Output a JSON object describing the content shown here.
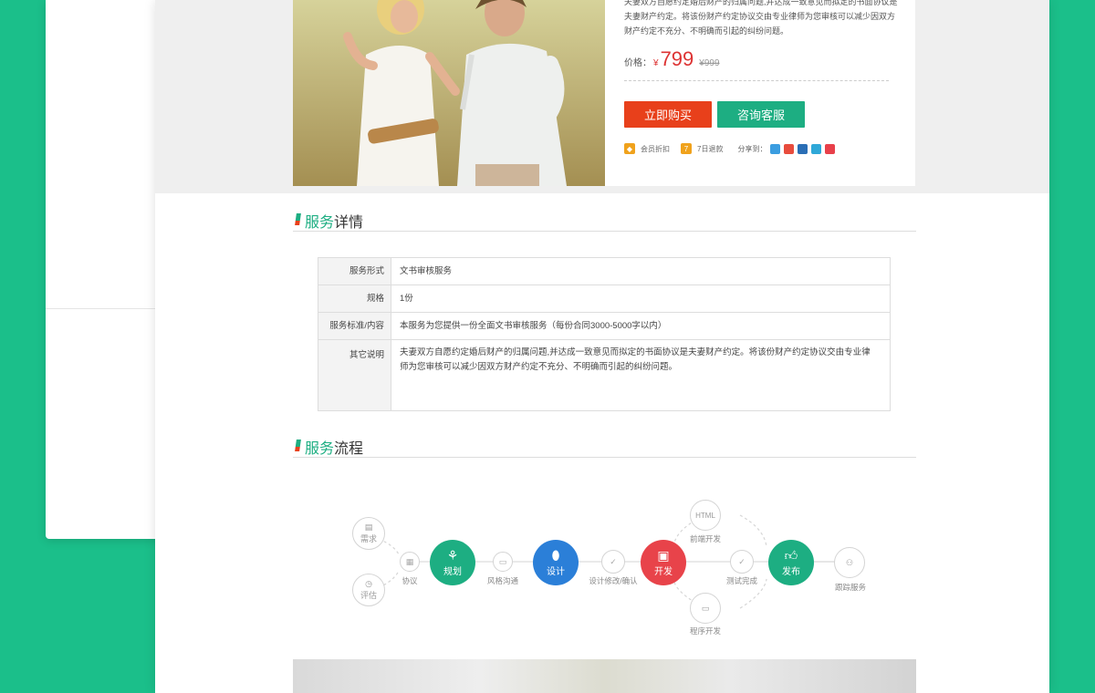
{
  "product": {
    "description": "夫妻双方自愿约定婚后财产的归属问题,并达成一致意见而拟定的书面协议是夫妻财产约定。将该份财产约定协议交由专业律师为您审核可以减少因双方财产约定不充分、不明确而引起的纠纷问题。",
    "price_label": "价格：",
    "currency": "¥",
    "price": "799",
    "old_price": "¥999",
    "buy_label": "立即购买",
    "service_label": "咨询客服",
    "perks": [
      {
        "icon": "member-discount-icon",
        "label": "会员折扣",
        "color": "#f0a21c"
      },
      {
        "icon": "seven-day-refund-icon",
        "label": "7日退款",
        "icon_text": "7",
        "color": "#f0a21c"
      }
    ],
    "share_label": "分享到：",
    "share_icons": [
      {
        "name": "qzone-share-icon",
        "color": "#3b9de0"
      },
      {
        "name": "weibo-share-icon",
        "color": "#e84c3d"
      },
      {
        "name": "renren-share-icon",
        "color": "#2a6eb5"
      },
      {
        "name": "qq-share-icon",
        "color": "#2fa8d8"
      },
      {
        "name": "douban-share-icon",
        "color": "#e8404a"
      }
    ]
  },
  "details": {
    "title_green": "服务",
    "title_dark": "详情",
    "rows": [
      {
        "key": "服务形式",
        "value": "文书审核服务"
      },
      {
        "key": "规格",
        "value": "1份"
      },
      {
        "key": "服务标准/内容",
        "value": "本服务为您提供一份全面文书审核服务（每份合同3000-5000字以内）"
      },
      {
        "key": "其它说明",
        "value": "夫妻双方自愿约定婚后财产的归属问题,并达成一致意见而拟定的书面协议是夫妻财产约定。将该份财产约定协议交由专业律师为您审核可以减少因双方财产约定不充分、不明确而引起的纠纷问题。"
      }
    ]
  },
  "process": {
    "title_green": "服务",
    "title_dark": "流程",
    "steps": {
      "demand": "需求",
      "evaluate": "评估",
      "agreement": "协议",
      "planning": "规划",
      "style": "风格沟通",
      "design": "设计",
      "design_revise": "设计修改/确认",
      "develop": "开发",
      "frontend_icon_text": "HTML",
      "frontend": "前端开发",
      "program": "程序开发",
      "test": "测试完成",
      "publish": "发布",
      "track": "跟踪服务"
    },
    "colors": {
      "green": "#1dae82",
      "blue": "#2b7fd8",
      "red": "#e8434a"
    }
  }
}
